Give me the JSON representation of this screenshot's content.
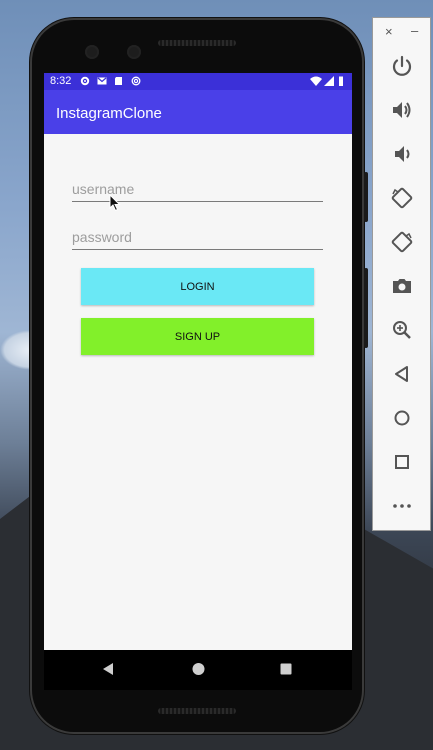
{
  "status_bar": {
    "time": "8:32"
  },
  "app_bar": {
    "title": "InstagramClone"
  },
  "form": {
    "username_placeholder": "username",
    "password_placeholder": "password",
    "login_label": "LOGIN",
    "signup_label": "SIGN UP"
  },
  "colors": {
    "status_bar": "#3b30d8",
    "app_bar": "#4a40e8",
    "login_button": "#6ae8f5",
    "signup_button": "#82f02a",
    "screen_bg": "#f6f6f6"
  },
  "emulator_toolbar": {
    "close_label": "×",
    "minimize_label": "–",
    "icons": [
      "power-icon",
      "volume-up-icon",
      "volume-down-icon",
      "rotate-left-icon",
      "rotate-right-icon",
      "camera-icon",
      "zoom-icon",
      "back-icon",
      "home-icon",
      "overview-icon",
      "more-icon"
    ]
  }
}
